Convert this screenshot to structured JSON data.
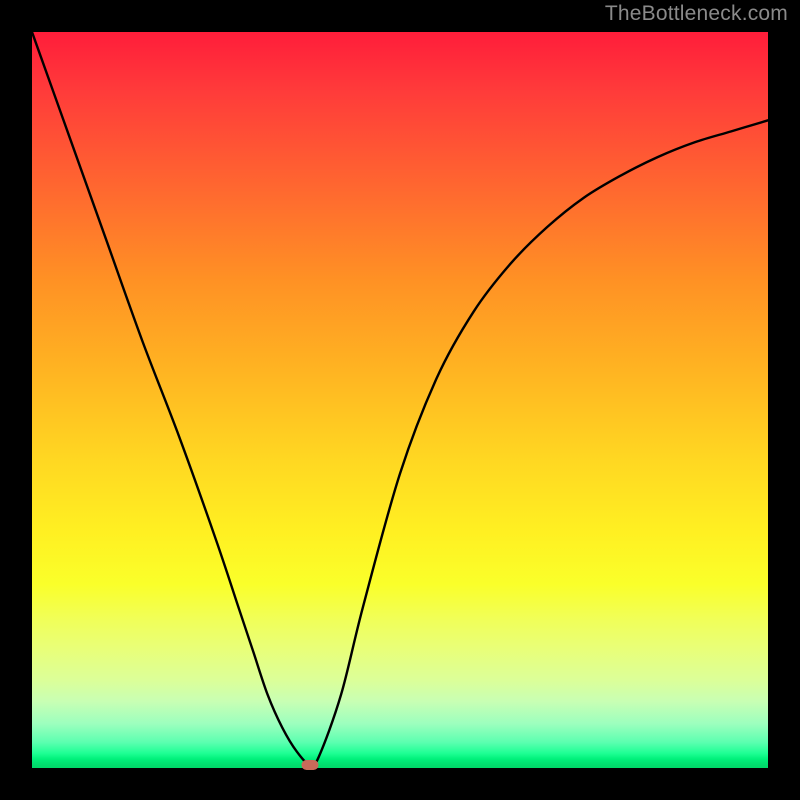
{
  "watermark": "TheBottleneck.com",
  "chart_data": {
    "type": "line",
    "title": "",
    "xlabel": "",
    "ylabel": "",
    "xlim": [
      0,
      100
    ],
    "ylim": [
      0,
      100
    ],
    "grid": false,
    "legend": false,
    "background_gradient": {
      "top": "#ff1d3a",
      "middle": "#ffe522",
      "bottom": "#00e070"
    },
    "series": [
      {
        "name": "bottleneck-curve",
        "color": "#000000",
        "x": [
          0,
          5,
          10,
          15,
          20,
          25,
          28,
          30,
          32,
          34,
          36,
          37.8,
          39,
          42,
          45,
          50,
          55,
          60,
          65,
          70,
          75,
          80,
          85,
          90,
          95,
          100
        ],
        "y": [
          100,
          86,
          72,
          58,
          45,
          31,
          22,
          16,
          10,
          5.5,
          2.2,
          0.4,
          1.6,
          10,
          22,
          40,
          53,
          62,
          68.5,
          73.5,
          77.5,
          80.5,
          83,
          85,
          86.5,
          88
        ]
      }
    ],
    "marker": {
      "name": "optimum-point",
      "x": 37.8,
      "y": 0.4,
      "color": "#c96a5a",
      "shape": "rounded-rect"
    }
  }
}
